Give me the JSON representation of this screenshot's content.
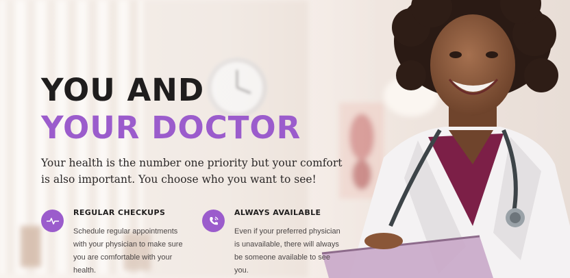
{
  "hero": {
    "title_line1": "YOU AND",
    "title_line2": "YOUR DOCTOR",
    "subtitle": "Your health is the number one priority but your comfort is also important. You choose who you want to see!"
  },
  "features": [
    {
      "title": "REGULAR CHECKUPS",
      "text": "Schedule regular appointments with your physician to make sure you are comfortable with your health.",
      "icon": "heartbeat-icon"
    },
    {
      "title": "ALWAYS AVAILABLE",
      "text": "Even if your preferred physician is unavailable, there will always be someone available to see you.",
      "icon": "phone-icon"
    }
  ],
  "colors": {
    "accent": "#9b5ccc",
    "heading": "#1f1d1d",
    "scrubs": "#7c1f47",
    "background": "#f3e9e3"
  }
}
